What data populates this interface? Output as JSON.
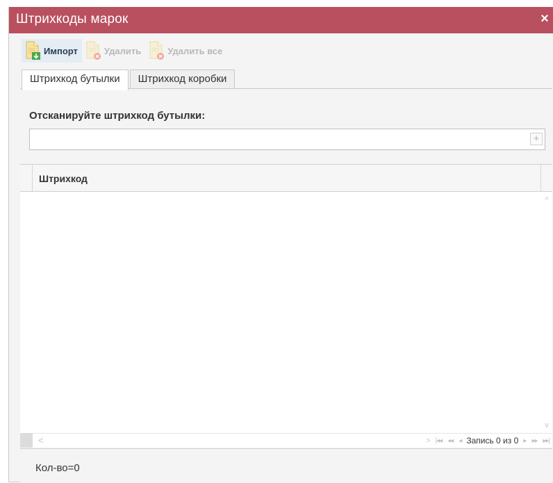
{
  "dialog": {
    "title": "Штрихкоды марок",
    "close_glyph": "×",
    "title_bar_color": "#b9505f"
  },
  "toolbar": {
    "import_label": "Импорт",
    "delete_label": "Удалить",
    "delete_all_label": "Удалить все",
    "import_icon": "document-import-icon",
    "delete_icon": "document-delete-icon",
    "delete_all_icon": "document-delete-all-icon"
  },
  "tabs": [
    {
      "label": "Штрихкод бутылки",
      "selected": true
    },
    {
      "label": "Штрихкод коробки",
      "selected": false
    }
  ],
  "scan": {
    "label": "Отсканируйте штрихкод бутылки:",
    "value": "",
    "add_glyph": "+"
  },
  "grid": {
    "columns": [
      "Штрихкод"
    ],
    "rows": []
  },
  "pager": {
    "record_text": "Запись 0 из 0",
    "scroll_left_glyph": "<",
    "scroll_up_glyph": "^",
    "scroll_down_glyph": "v",
    "next_glyph": ">",
    "first_glyph": "|◂◂",
    "prev_page_glyph": "◂◂",
    "prev_glyph": "◂",
    "next_record_glyph": "▸",
    "next_page_glyph": "▸▸",
    "last_glyph": "▸▸|"
  },
  "footer": {
    "count_text": "Кол-во=0"
  }
}
